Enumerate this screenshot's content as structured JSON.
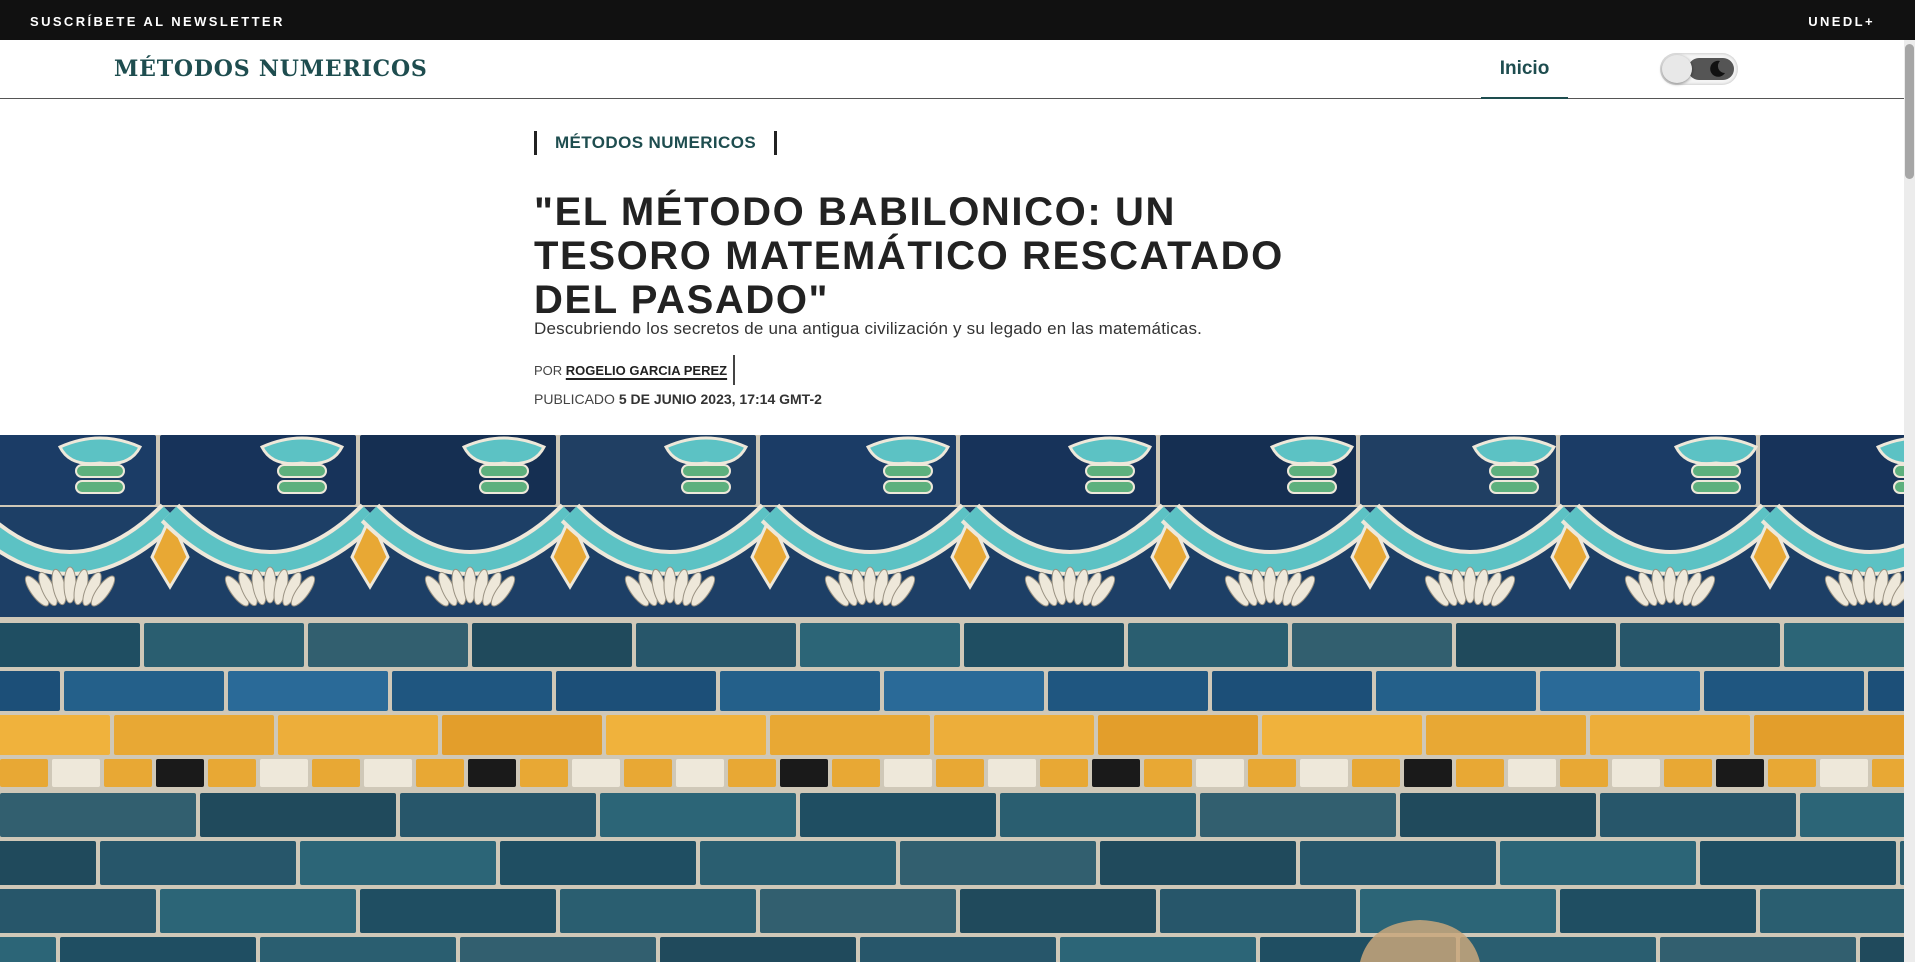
{
  "topbar": {
    "newsletter_label": "SUSCRÍBETE AL NEWSLETTER",
    "brand_plus": "UNEDL+"
  },
  "header": {
    "logo": "MÉTODOS NUMERICOS",
    "nav": [
      {
        "label": "Inicio",
        "active": true
      }
    ],
    "theme_toggle": {
      "mode": "light",
      "icon": "moon-icon"
    }
  },
  "article": {
    "category": "MÉTODOS NUMERICOS",
    "title": "\"EL MÉTODO BABILONICO: UN TESORO MATEMÁTICO RESCATADO DEL PASADO\"",
    "subtitle": "Descubriendo los secretos de una antigua civilización y su legado en las matemáticas.",
    "byline_prefix": "POR",
    "author": "ROGELIO GARCIA PEREZ",
    "published_prefix": "PUBLICADO",
    "published_date": "5 DE JUNIO 2023, 17:14 GMT-2"
  },
  "hero": {
    "image": "glazed-brick-wall-image",
    "colors": {
      "blue_tile": "#27566a",
      "dark_blue_tile": "#17335a",
      "turquoise": "#5cc2c4",
      "yellow": "#e8a834",
      "white": "#eee8da",
      "green": "#5db07d"
    }
  },
  "colors": {
    "accent": "#1e4d4f",
    "topbar_bg": "#111111",
    "text": "#222222"
  }
}
